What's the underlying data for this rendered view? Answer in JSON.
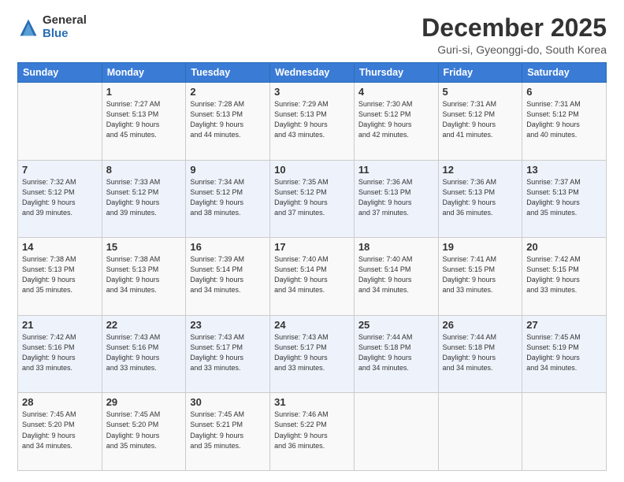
{
  "logo": {
    "general": "General",
    "blue": "Blue"
  },
  "header": {
    "title": "December 2025",
    "subtitle": "Guri-si, Gyeonggi-do, South Korea"
  },
  "weekdays": [
    "Sunday",
    "Monday",
    "Tuesday",
    "Wednesday",
    "Thursday",
    "Friday",
    "Saturday"
  ],
  "weeks": [
    [
      {
        "num": "",
        "info": ""
      },
      {
        "num": "1",
        "info": "Sunrise: 7:27 AM\nSunset: 5:13 PM\nDaylight: 9 hours\nand 45 minutes."
      },
      {
        "num": "2",
        "info": "Sunrise: 7:28 AM\nSunset: 5:13 PM\nDaylight: 9 hours\nand 44 minutes."
      },
      {
        "num": "3",
        "info": "Sunrise: 7:29 AM\nSunset: 5:13 PM\nDaylight: 9 hours\nand 43 minutes."
      },
      {
        "num": "4",
        "info": "Sunrise: 7:30 AM\nSunset: 5:12 PM\nDaylight: 9 hours\nand 42 minutes."
      },
      {
        "num": "5",
        "info": "Sunrise: 7:31 AM\nSunset: 5:12 PM\nDaylight: 9 hours\nand 41 minutes."
      },
      {
        "num": "6",
        "info": "Sunrise: 7:31 AM\nSunset: 5:12 PM\nDaylight: 9 hours\nand 40 minutes."
      }
    ],
    [
      {
        "num": "7",
        "info": "Sunrise: 7:32 AM\nSunset: 5:12 PM\nDaylight: 9 hours\nand 39 minutes."
      },
      {
        "num": "8",
        "info": "Sunrise: 7:33 AM\nSunset: 5:12 PM\nDaylight: 9 hours\nand 39 minutes."
      },
      {
        "num": "9",
        "info": "Sunrise: 7:34 AM\nSunset: 5:12 PM\nDaylight: 9 hours\nand 38 minutes."
      },
      {
        "num": "10",
        "info": "Sunrise: 7:35 AM\nSunset: 5:12 PM\nDaylight: 9 hours\nand 37 minutes."
      },
      {
        "num": "11",
        "info": "Sunrise: 7:36 AM\nSunset: 5:13 PM\nDaylight: 9 hours\nand 37 minutes."
      },
      {
        "num": "12",
        "info": "Sunrise: 7:36 AM\nSunset: 5:13 PM\nDaylight: 9 hours\nand 36 minutes."
      },
      {
        "num": "13",
        "info": "Sunrise: 7:37 AM\nSunset: 5:13 PM\nDaylight: 9 hours\nand 35 minutes."
      }
    ],
    [
      {
        "num": "14",
        "info": "Sunrise: 7:38 AM\nSunset: 5:13 PM\nDaylight: 9 hours\nand 35 minutes."
      },
      {
        "num": "15",
        "info": "Sunrise: 7:38 AM\nSunset: 5:13 PM\nDaylight: 9 hours\nand 34 minutes."
      },
      {
        "num": "16",
        "info": "Sunrise: 7:39 AM\nSunset: 5:14 PM\nDaylight: 9 hours\nand 34 minutes."
      },
      {
        "num": "17",
        "info": "Sunrise: 7:40 AM\nSunset: 5:14 PM\nDaylight: 9 hours\nand 34 minutes."
      },
      {
        "num": "18",
        "info": "Sunrise: 7:40 AM\nSunset: 5:14 PM\nDaylight: 9 hours\nand 34 minutes."
      },
      {
        "num": "19",
        "info": "Sunrise: 7:41 AM\nSunset: 5:15 PM\nDaylight: 9 hours\nand 33 minutes."
      },
      {
        "num": "20",
        "info": "Sunrise: 7:42 AM\nSunset: 5:15 PM\nDaylight: 9 hours\nand 33 minutes."
      }
    ],
    [
      {
        "num": "21",
        "info": "Sunrise: 7:42 AM\nSunset: 5:16 PM\nDaylight: 9 hours\nand 33 minutes."
      },
      {
        "num": "22",
        "info": "Sunrise: 7:43 AM\nSunset: 5:16 PM\nDaylight: 9 hours\nand 33 minutes."
      },
      {
        "num": "23",
        "info": "Sunrise: 7:43 AM\nSunset: 5:17 PM\nDaylight: 9 hours\nand 33 minutes."
      },
      {
        "num": "24",
        "info": "Sunrise: 7:43 AM\nSunset: 5:17 PM\nDaylight: 9 hours\nand 33 minutes."
      },
      {
        "num": "25",
        "info": "Sunrise: 7:44 AM\nSunset: 5:18 PM\nDaylight: 9 hours\nand 34 minutes."
      },
      {
        "num": "26",
        "info": "Sunrise: 7:44 AM\nSunset: 5:18 PM\nDaylight: 9 hours\nand 34 minutes."
      },
      {
        "num": "27",
        "info": "Sunrise: 7:45 AM\nSunset: 5:19 PM\nDaylight: 9 hours\nand 34 minutes."
      }
    ],
    [
      {
        "num": "28",
        "info": "Sunrise: 7:45 AM\nSunset: 5:20 PM\nDaylight: 9 hours\nand 34 minutes."
      },
      {
        "num": "29",
        "info": "Sunrise: 7:45 AM\nSunset: 5:20 PM\nDaylight: 9 hours\nand 35 minutes."
      },
      {
        "num": "30",
        "info": "Sunrise: 7:45 AM\nSunset: 5:21 PM\nDaylight: 9 hours\nand 35 minutes."
      },
      {
        "num": "31",
        "info": "Sunrise: 7:46 AM\nSunset: 5:22 PM\nDaylight: 9 hours\nand 36 minutes."
      },
      {
        "num": "",
        "info": ""
      },
      {
        "num": "",
        "info": ""
      },
      {
        "num": "",
        "info": ""
      }
    ]
  ]
}
